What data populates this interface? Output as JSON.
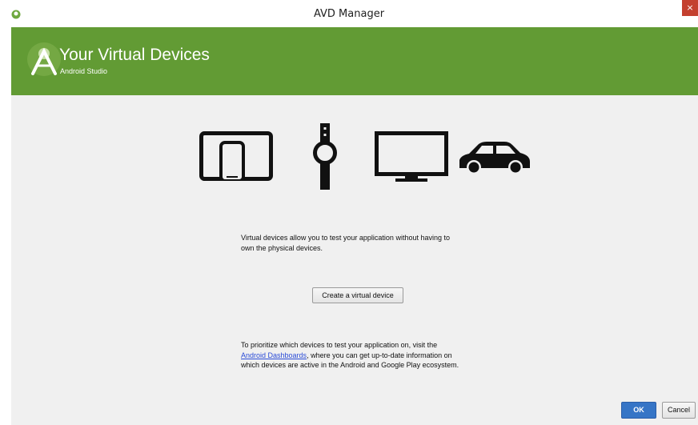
{
  "window": {
    "title": "AVD Manager",
    "close_glyph": "×"
  },
  "banner": {
    "title": "Your Virtual Devices",
    "subtitle": "Android Studio",
    "color": "#629b34"
  },
  "icons": [
    "android-studio-logo-icon",
    "tablet-phone-icon",
    "smartwatch-icon",
    "tv-icon",
    "car-icon"
  ],
  "description": {
    "line1": "Virtual devices allow you to test your application without having to",
    "line2": "own the physical devices."
  },
  "create_button": {
    "label": "Create a virtual device"
  },
  "info": {
    "line1": "To prioritize which devices to test your application on, visit the",
    "link_text": "Android Dashboards",
    "line2_rest": ", where you can get up-to-date information on",
    "line3": "which devices are active in the Android and Google Play ecosystem."
  },
  "footer": {
    "ok_label": "OK",
    "cancel_label": "Cancel"
  },
  "colors": {
    "accent": "#3675c6",
    "close": "#c4402f",
    "link": "#2a4bd7"
  }
}
